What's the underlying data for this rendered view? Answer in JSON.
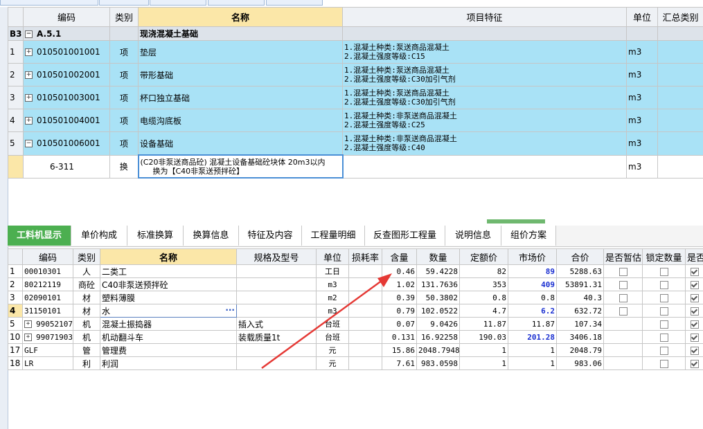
{
  "top_grid": {
    "headers": [
      "编码",
      "类别",
      "名称",
      "项目特征",
      "单位",
      "汇总类别"
    ],
    "group": {
      "id": "B3",
      "code": "A.5.1",
      "name": "现浇混凝土基础"
    },
    "items": [
      {
        "row": "1",
        "code": "010501001001",
        "type": "项",
        "name": "垫层",
        "feat1": "1.混凝土种类:泵送商品混凝土",
        "feat2": "2.混凝土强度等级:C15",
        "unit": "m3",
        "sign": "+"
      },
      {
        "row": "2",
        "code": "010501002001",
        "type": "项",
        "name": "带形基础",
        "feat1": "1.混凝土种类:泵送商品混凝土",
        "feat2": "2.混凝土强度等级:C30加引气剂",
        "unit": "m3",
        "sign": "+"
      },
      {
        "row": "3",
        "code": "010501003001",
        "type": "项",
        "name": "杯口独立基础",
        "feat1": "1.混凝土种类:泵送商品混凝土",
        "feat2": "2.混凝土强度等级:C30加引气剂",
        "unit": "m3",
        "sign": "+"
      },
      {
        "row": "4",
        "code": "010501004001",
        "type": "项",
        "name": "电缆沟底板",
        "feat1": "1.混凝土种类:非泵送商品混凝土",
        "feat2": "2.混凝土强度等级:C25",
        "unit": "m3",
        "sign": "+"
      },
      {
        "row": "5",
        "code": "010501006001",
        "type": "项",
        "name": "设备基础",
        "feat1": "1.混凝土种类:非泵送商品混凝土",
        "feat2": "2.混凝土强度等级:C40",
        "unit": "m3",
        "sign": "−"
      }
    ],
    "sub": {
      "code": "6-311",
      "type": "换",
      "name1": "(C20非泵送商品砼) 混凝土设备基础砼块体 20m3以内",
      "name2": "换为【C40非泵送预拌砼】",
      "unit": "m3"
    }
  },
  "tabs": [
    "工料机显示",
    "单价构成",
    "标准换算",
    "换算信息",
    "特征及内容",
    "工程量明细",
    "反查图形工程量",
    "说明信息",
    "组价方案"
  ],
  "bottom_grid": {
    "headers": [
      "编码",
      "类别",
      "名称",
      "规格及型号",
      "单位",
      "损耗率",
      "含量",
      "数量",
      "定额价",
      "市场价",
      "合价",
      "是否暂估",
      "锁定数量",
      "是否计"
    ],
    "rows": [
      {
        "row": "1",
        "code": "00010301",
        "type": "人",
        "name": "二类工",
        "spec": "",
        "unit": "工日",
        "loss": "",
        "content": "0.46",
        "qty": "59.4228",
        "quota": "82",
        "market": "89",
        "total": "5288.63",
        "est": false,
        "lock": false,
        "calc": true,
        "sign": ""
      },
      {
        "row": "2",
        "code": "80212119",
        "type": "商砼",
        "name": "C40非泵送预拌砼",
        "spec": "",
        "unit": "m3",
        "loss": "",
        "content": "1.02",
        "qty": "131.7636",
        "quota": "353",
        "market": "409",
        "total": "53891.31",
        "est": false,
        "lock": false,
        "calc": true,
        "sign": ""
      },
      {
        "row": "3",
        "code": "02090101",
        "type": "材",
        "name": "塑料薄膜",
        "spec": "",
        "unit": "m2",
        "loss": "",
        "content": "0.39",
        "qty": "50.3802",
        "quota": "0.8",
        "market": "0.8",
        "total": "40.3",
        "est": false,
        "lock": false,
        "calc": true,
        "sign": ""
      },
      {
        "row": "4",
        "code": "31150101",
        "type": "材",
        "name": "水",
        "spec": "",
        "unit": "m3",
        "loss": "",
        "content": "0.79",
        "qty": "102.0522",
        "quota": "4.7",
        "market": "6.2",
        "total": "632.72",
        "est": false,
        "lock": false,
        "calc": true,
        "sign": ""
      },
      {
        "row": "5",
        "code": "99052107",
        "type": "机",
        "name": "混凝土振捣器",
        "spec": "插入式",
        "unit": "台班",
        "loss": "",
        "content": "0.07",
        "qty": "9.0426",
        "quota": "11.87",
        "market": "11.87",
        "total": "107.34",
        "est": null,
        "lock": false,
        "calc": true,
        "sign": "+"
      },
      {
        "row": "10",
        "code": "99071903",
        "type": "机",
        "name": "机动翻斗车",
        "spec": "装载质量1t",
        "unit": "台班",
        "loss": "",
        "content": "0.131",
        "qty": "16.92258",
        "quota": "190.03",
        "market": "201.28",
        "total": "3406.18",
        "est": null,
        "lock": false,
        "calc": true,
        "sign": "+"
      },
      {
        "row": "17",
        "code": "GLF",
        "type": "管",
        "name": "管理费",
        "spec": "",
        "unit": "元",
        "loss": "",
        "content": "15.86",
        "qty": "2048.7948",
        "quota": "1",
        "market": "1",
        "total": "2048.79",
        "est": null,
        "lock": false,
        "calc": true,
        "sign": ""
      },
      {
        "row": "18",
        "code": "LR",
        "type": "利",
        "name": "利润",
        "spec": "",
        "unit": "元",
        "loss": "",
        "content": "7.61",
        "qty": "983.0598",
        "quota": "1",
        "market": "1",
        "total": "983.06",
        "est": null,
        "lock": false,
        "calc": true,
        "sign": ""
      }
    ],
    "edit_ellipsis": "···"
  },
  "colors": {
    "accent_green": "#4caf50",
    "row_blue": "#a9e2f6",
    "highlight_yellow": "#fbe7a8",
    "arrow_red": "#e53935",
    "price_blue": "#1a2fd1"
  }
}
